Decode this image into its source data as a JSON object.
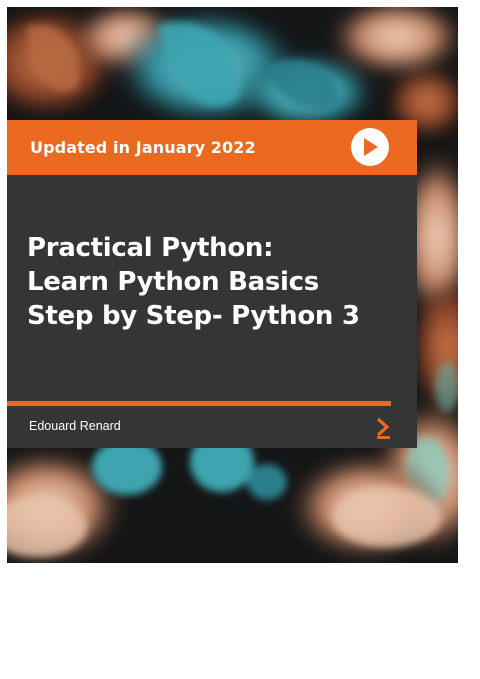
{
  "cover": {
    "banner_text": "Updated in January 2022",
    "title_lines": [
      "Practical Python:",
      "Learn Python Basics",
      "Step by Step- Python 3"
    ],
    "author": "Edouard Renard"
  },
  "icons": {
    "play": "play-icon",
    "next": "chevron-right-icon"
  },
  "colors": {
    "accent": "#ec6a1f",
    "panel": "#343537",
    "background": "#141516"
  }
}
